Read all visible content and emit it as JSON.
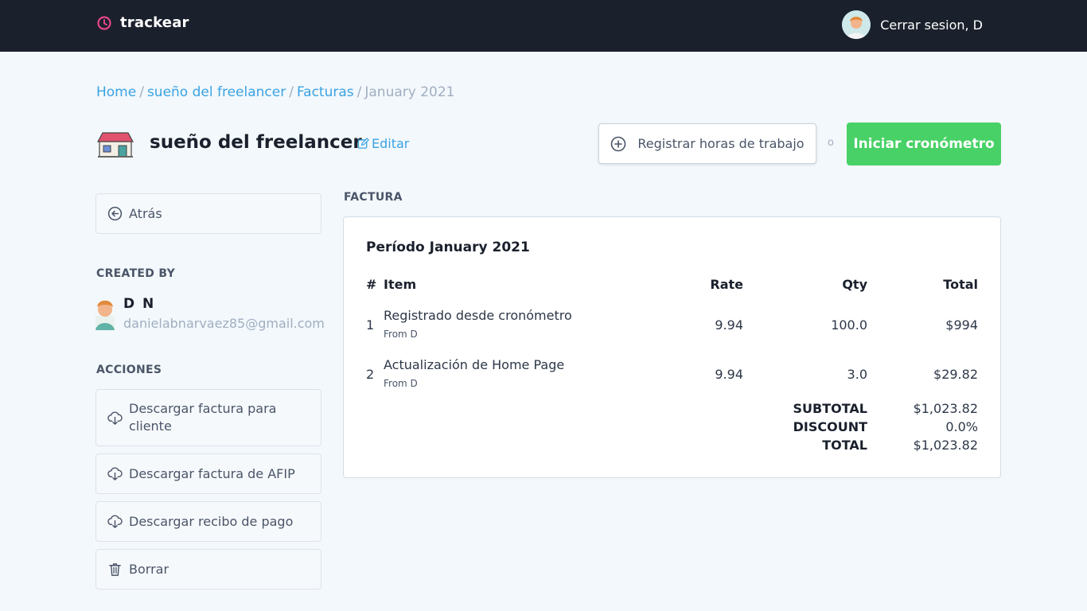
{
  "nav": {
    "brand": "trackear",
    "logout_label": "Cerrar sesion, D"
  },
  "breadcrumb": {
    "home": "Home",
    "project": "sueño del freelancer",
    "invoices": "Facturas",
    "current": "January 2021",
    "separator": "/"
  },
  "project": {
    "title": "sueño del freelancer",
    "edit_label": "Editar"
  },
  "actions_top": {
    "register_label": "Registrar horas de trabajo",
    "or_label": "o",
    "start_timer_label": "Iniciar cronómetro"
  },
  "sidebar": {
    "back_label": "Atrás",
    "created_by_heading": "CREATED BY",
    "creator_name": "D N",
    "creator_email": "danielabnarvaez85@gmail.com",
    "actions_heading": "ACCIONES",
    "actions": [
      {
        "label": "Descargar factura para cliente",
        "icon": "cloud-download-icon"
      },
      {
        "label": "Descargar factura de AFIP",
        "icon": "cloud-download-icon"
      },
      {
        "label": "Descargar recibo de pago",
        "icon": "cloud-download-icon"
      },
      {
        "label": "Borrar",
        "icon": "trash-icon"
      }
    ]
  },
  "invoice": {
    "section_label": "FACTURA",
    "period": "Período January 2021",
    "columns": {
      "num": "#",
      "item": "Item",
      "rate": "Rate",
      "qty": "Qty",
      "total": "Total"
    },
    "rows": [
      {
        "num": "1",
        "item": "Registrado desde cronómetro",
        "from": "From D",
        "rate": "9.94",
        "qty": "100.0",
        "total": "$994"
      },
      {
        "num": "2",
        "item": "Actualización de Home Page",
        "from": "From D",
        "rate": "9.94",
        "qty": "3.0",
        "total": "$29.82"
      }
    ],
    "subtotal_label": "SUBTOTAL",
    "subtotal": "$1,023.82",
    "discount_label": "DISCOUNT",
    "discount": "0.0%",
    "total_label": "TOTAL",
    "total": "$1,023.82"
  },
  "colors": {
    "topbar": "#1a202c",
    "link": "#3aa3e3",
    "primary_button": "#48d166",
    "brand_icon": "#e4458a"
  }
}
